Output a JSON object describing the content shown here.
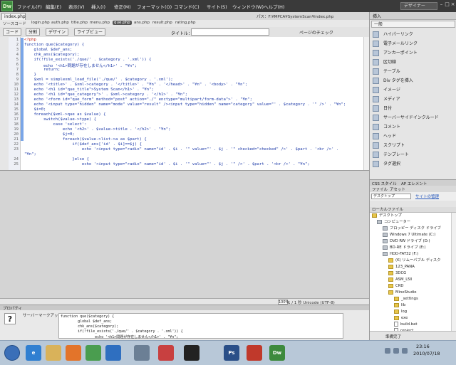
{
  "app": {
    "logo": "Dw",
    "menus": [
      "ファイル(F)",
      "編集(E)",
      "表示(V)",
      "挿入(I)",
      "修正(M)",
      "フォーマット(O)",
      "コマンド(C)",
      "サイト(S)",
      "ウィンドウ(W)",
      "ヘルプ(H)"
    ],
    "workspace": "デザイナー",
    "window_controls": [
      "–",
      "□",
      "×"
    ]
  },
  "document": {
    "tab": "index.php",
    "path": "パス：F:¥MPCA¥SystemScan¥index.php",
    "related_files": [
      "ソースコード",
      "login.php",
      "auth.php",
      "title.php",
      "menu.php",
      "que.php",
      "ans.php",
      "result.php",
      "rating.php"
    ],
    "active_related": "que.php",
    "toolbar": {
      "code": "コード",
      "split": "分割",
      "design": "デザイン",
      "live_view": "ライブビュー",
      "title_label": "タイトル：",
      "title_value": "",
      "browser_check": "ページのチェック"
    },
    "line_numbers": [
      "1",
      "2",
      "3",
      "4",
      "5",
      "6",
      "7",
      "8",
      "9",
      "10",
      "11",
      "12",
      "13",
      "14",
      "15",
      "16",
      "17",
      "18",
      "19",
      "20",
      "21",
      "22",
      "23",
      "",
      "24",
      "25"
    ],
    "code_lines": [
      "<?php",
      "function que($category) {",
      "    global $def_ans;",
      "    chk_ans($category);",
      "    if(!file_exists('./que/' . $category . '.xml')) {",
      "        echo '<h1>問題が存在しません</h1>' . \"¥n\";",
      "        return;",
      "    }",
      "    $xml = simplexml_load_file('./que/' . $category . '.xml');",
      "    echo '<title>' . $xml->category . '</title>' . \"¥n\" . '</head>' . \"¥n\" . '<body>' . \"¥n\";",
      "    echo '<h1 id=\"que_title\">System Scan</h1>' . \"¥n\";",
      "    echo '<h1 id=\"que_category\">' . $xml->category . '</h1>' . \"¥n\";",
      "    echo '<form id=\"que_form\" method=\"post\" action=\"./\" enctype=\"multipart/form-data\">' . \"¥n\";",
      "    echo '<input type=\"hidden\" name=\"mode\" value=\"result\" /><input type=\"hidden\" name=\"category\" value=\"' . $category . '\" />' . \"¥n\";",
      "    $i=0;",
      "    foreach($xml->que as $value) {",
      "        switch($value->type) {",
      "            case 'select':",
      "                echo '<h2>' . $value->title . '</h2>' . \"¥n\";",
      "                $j=0;",
      "                foreach($value->list->a as $part) {",
      "                    if($def_ans['id' . $i]==$j) {",
      "                        echo '<input type=\"radio\" name=\"id' . $i . '\" value=\"' . $j . '\" checked=\"checked\" />' . $part . '<br />' .",
      "\"¥n\";",
      "                    }else {",
      "                        echo '<input type=\"radio\" name=\"id' . $i . '\" value=\"' . $j . '\" />' . $part . '<br />' . \"¥n\";"
    ]
  },
  "status": {
    "zoom": "100%",
    "info": "1 / 1 秒  Unicode (UTF-8)"
  },
  "properties": {
    "header": "プロパティ",
    "icon": "?",
    "label": "サーバーマークアップ",
    "code_lines": [
      "function que($category) {",
      "        global $def_ans;",
      "        chk_ans($category);",
      "        if(!file_exists('./que/' . $category . '.xml')) {",
      "                echo '<h1>問題が存在しません</h1>' . \"¥n\";"
    ]
  },
  "insert_panel": {
    "tab": "挿入",
    "category": "一般",
    "items": [
      "ハイパーリンク",
      "電子メールリンク",
      "アンカーポイント",
      "区切線",
      "テーブル",
      "Div タグを挿入",
      "イメージ",
      "メディア",
      "日付",
      "サーバーサイドインクルード",
      "コメント",
      "ヘッド",
      "スクリプト",
      "テンプレート",
      "タグ選択"
    ]
  },
  "files_panel": {
    "css_tabs": [
      "CSS スタイル",
      "AP エレメント"
    ],
    "file_tabs": [
      "ファイル",
      "アセット"
    ],
    "site": "デスクトップ",
    "site_link": "サイトの管理",
    "local_header": "ローカルファイル",
    "tree": [
      {
        "label": "デスクトップ",
        "indent": 0,
        "kind": "folder"
      },
      {
        "label": "コンピューター",
        "indent": 1,
        "kind": "folder"
      },
      {
        "label": "フロッピー ディスク ドライブ",
        "indent": 2,
        "kind": "drive"
      },
      {
        "label": "Windows 7 Ultimate (C:)",
        "indent": 2,
        "kind": "drive"
      },
      {
        "label": "DVD RW ドライブ (D:)",
        "indent": 2,
        "kind": "drive"
      },
      {
        "label": "BD-RE ドライブ (E:)",
        "indent": 2,
        "kind": "drive"
      },
      {
        "label": "HDD-FAT32 (F:)",
        "indent": 2,
        "kind": "drive"
      },
      {
        "label": "(K) リムーバブル ディスク",
        "indent": 3,
        "kind": "folder"
      },
      {
        "label": "123_PANA",
        "indent": 3,
        "kind": "folder"
      },
      {
        "label": "3DCG",
        "indent": 3,
        "kind": "folder"
      },
      {
        "label": "ASM_L5ll",
        "indent": 3,
        "kind": "folder"
      },
      {
        "label": "CRD",
        "indent": 3,
        "kind": "folder"
      },
      {
        "label": "MineStudio",
        "indent": 3,
        "kind": "folder"
      },
      {
        "label": "_settings",
        "indent": 4,
        "kind": "folder"
      },
      {
        "label": "lib",
        "indent": 4,
        "kind": "folder"
      },
      {
        "label": "log",
        "indent": 4,
        "kind": "folder"
      },
      {
        "label": "exe",
        "indent": 4,
        "kind": "folder"
      },
      {
        "label": "build.bat",
        "indent": 4,
        "kind": "file"
      },
      {
        "label": "project",
        "indent": 4,
        "kind": "file"
      }
    ],
    "ready": "準備完了"
  },
  "taskbar": {
    "icons": [
      {
        "name": "ie-icon",
        "label": "e",
        "color": "#2f7fd1"
      },
      {
        "name": "explorer-icon",
        "label": "",
        "color": "#d9b25a"
      },
      {
        "name": "firefox-icon",
        "label": "",
        "color": "#e3742a"
      },
      {
        "name": "chrome-icon",
        "label": "",
        "color": "#4a9d4f"
      },
      {
        "name": "media-player-icon",
        "label": "",
        "color": "#2f6fc0"
      },
      {
        "name": "mail-icon",
        "label": "",
        "color": "#6b7f95"
      },
      {
        "name": "paint-icon",
        "label": "",
        "color": "#c84040"
      },
      {
        "name": "black-app-icon",
        "label": "",
        "color": "#222222"
      },
      {
        "name": "photoshop-icon",
        "label": "Ps",
        "color": "#2a4f88"
      },
      {
        "name": "red-app-icon",
        "label": "",
        "color": "#c0392b"
      },
      {
        "name": "dreamweaver-icon",
        "label": "Dw",
        "color": "#3d8a3d"
      }
    ],
    "time": "23:16",
    "date": "2010/07/18"
  }
}
